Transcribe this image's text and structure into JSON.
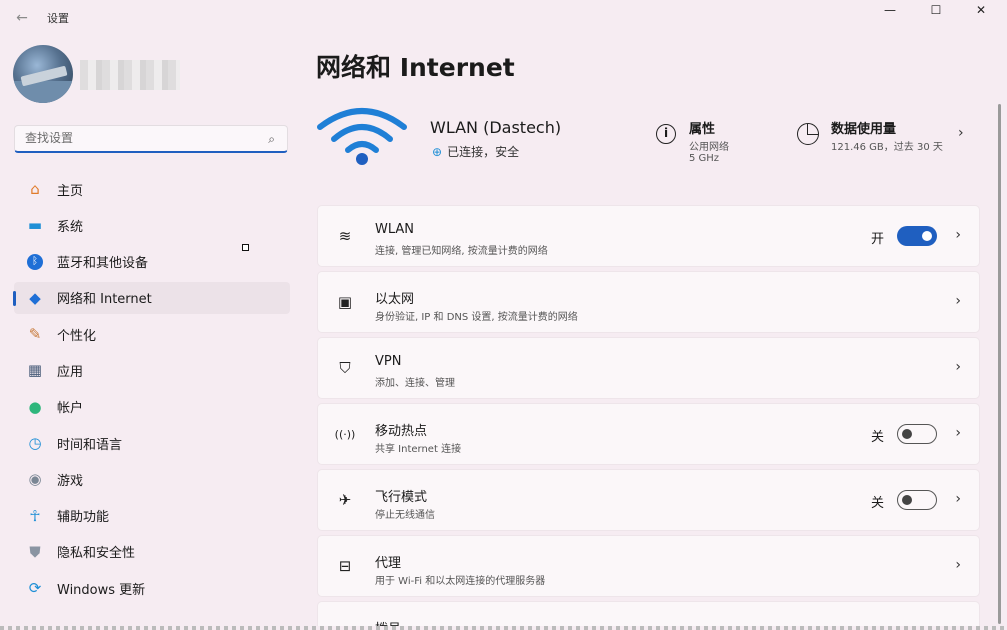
{
  "window": {
    "title": "设置",
    "back_glyph": "←",
    "minimize_glyph": "—",
    "maximize_glyph": "☐",
    "close_glyph": "✕"
  },
  "search": {
    "placeholder": "查找设置"
  },
  "sidebar": {
    "items": [
      {
        "label": "主页",
        "icon": "home-icon",
        "glyph": "⌂",
        "color": "#e07b2a"
      },
      {
        "label": "系统",
        "icon": "monitor-icon",
        "glyph": "▬",
        "color": "#1f8fd6"
      },
      {
        "label": "蓝牙和其他设备",
        "icon": "bluetooth-icon",
        "glyph": "ᛒ",
        "color": "#1f6fd6"
      },
      {
        "label": "网络和 Internet",
        "icon": "wifi-icon",
        "glyph": "◆",
        "color": "#1f6fd6",
        "active": true
      },
      {
        "label": "个性化",
        "icon": "brush-icon",
        "glyph": "✎",
        "color": "#c77a3a"
      },
      {
        "label": "应用",
        "icon": "apps-icon",
        "glyph": "▦",
        "color": "#4a5d7a"
      },
      {
        "label": "帐户",
        "icon": "account-icon",
        "glyph": "●",
        "color": "#2fb67c"
      },
      {
        "label": "时间和语言",
        "icon": "clock-globe-icon",
        "glyph": "◷",
        "color": "#1f8fd6"
      },
      {
        "label": "游戏",
        "icon": "gamepad-icon",
        "glyph": "◉",
        "color": "#7a8694"
      },
      {
        "label": "辅助功能",
        "icon": "accessibility-icon",
        "glyph": "☥",
        "color": "#1f8fd6"
      },
      {
        "label": "隐私和安全性",
        "icon": "shield-icon",
        "glyph": "⛊",
        "color": "#8a94a2"
      },
      {
        "label": "Windows 更新",
        "icon": "update-icon",
        "glyph": "⟳",
        "color": "#1f8fd6"
      }
    ]
  },
  "main": {
    "title": "网络和 Internet",
    "hero": {
      "network_name": "WLAN (Dastech)",
      "status": "已连接，安全",
      "properties_title": "属性",
      "properties_line1": "公用网络",
      "properties_line2": "5 GHz",
      "usage_title": "数据使用量",
      "usage_detail": "121.46 GB，过去 30 天"
    },
    "cards": [
      {
        "title": "WLAN",
        "subtitle": "连接, 管理已知网络, 按流量计费的网络",
        "icon": "wifi-icon",
        "glyph": "≋",
        "toggle": "开",
        "toggle_on": true
      },
      {
        "title": "以太网",
        "subtitle": "身份验证, IP 和 DNS 设置, 按流量计费的网络",
        "icon": "ethernet-icon",
        "glyph": "▣"
      },
      {
        "title": "VPN",
        "subtitle": "添加、连接、管理",
        "icon": "vpn-shield-icon",
        "glyph": "⛉"
      },
      {
        "title": "移动热点",
        "subtitle": "共享 Internet 连接",
        "icon": "hotspot-icon",
        "glyph": "((·))",
        "toggle": "关",
        "toggle_on": false
      },
      {
        "title": "飞行模式",
        "subtitle": "停止无线通信",
        "icon": "airplane-icon",
        "glyph": "✈",
        "toggle": "关",
        "toggle_on": false
      },
      {
        "title": "代理",
        "subtitle": "用于 Wi-Fi 和以太网连接的代理服务器",
        "icon": "proxy-icon",
        "glyph": "⊟"
      },
      {
        "title": "拨号",
        "subtitle": "",
        "icon": "dialup-icon",
        "glyph": "☎"
      }
    ]
  },
  "accent": "#1f5fc0"
}
